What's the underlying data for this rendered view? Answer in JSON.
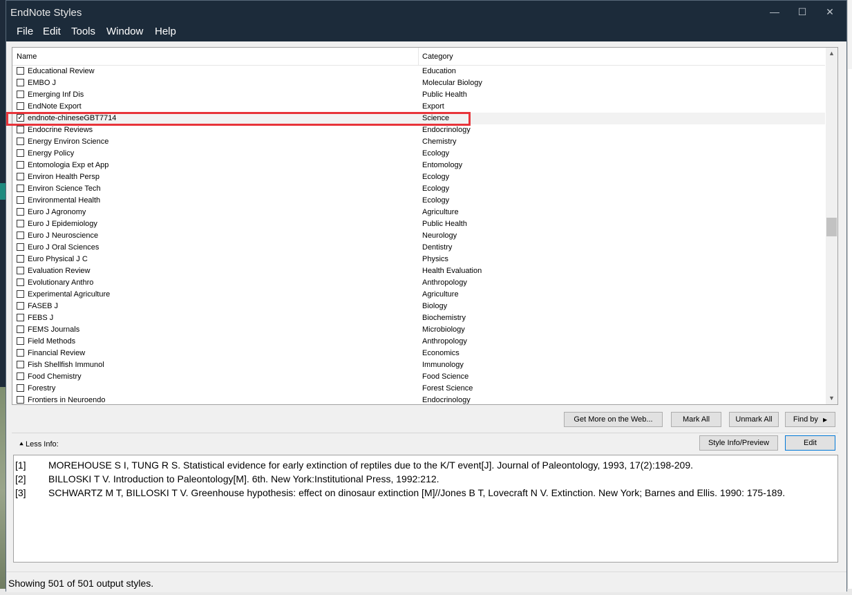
{
  "window": {
    "title": "EndNote Styles"
  },
  "menu": [
    "File",
    "Edit",
    "Tools",
    "Window",
    "Help"
  ],
  "columns": {
    "name": "Name",
    "category": "Category"
  },
  "styles": [
    {
      "name": "Educational Review",
      "category": "Education",
      "checked": false
    },
    {
      "name": "EMBO J",
      "category": "Molecular Biology",
      "checked": false
    },
    {
      "name": "Emerging Inf Dis",
      "category": "Public Health",
      "checked": false
    },
    {
      "name": "EndNote Export",
      "category": "Export",
      "checked": false
    },
    {
      "name": "endnote-chineseGBT7714",
      "category": "Science",
      "checked": true,
      "selected": true
    },
    {
      "name": "Endocrine Reviews",
      "category": "Endocrinology",
      "checked": false
    },
    {
      "name": "Energy Environ Science",
      "category": "Chemistry",
      "checked": false
    },
    {
      "name": "Energy Policy",
      "category": "Ecology",
      "checked": false
    },
    {
      "name": "Entomologia Exp et App",
      "category": "Entomology",
      "checked": false
    },
    {
      "name": "Environ Health Persp",
      "category": "Ecology",
      "checked": false
    },
    {
      "name": "Environ Science Tech",
      "category": "Ecology",
      "checked": false
    },
    {
      "name": "Environmental Health",
      "category": "Ecology",
      "checked": false
    },
    {
      "name": "Euro J Agronomy",
      "category": "Agriculture",
      "checked": false
    },
    {
      "name": "Euro J Epidemiology",
      "category": "Public Health",
      "checked": false
    },
    {
      "name": "Euro J Neuroscience",
      "category": "Neurology",
      "checked": false
    },
    {
      "name": "Euro J Oral Sciences",
      "category": "Dentistry",
      "checked": false
    },
    {
      "name": "Euro Physical J C",
      "category": "Physics",
      "checked": false
    },
    {
      "name": "Evaluation Review",
      "category": "Health Evaluation",
      "checked": false
    },
    {
      "name": "Evolutionary Anthro",
      "category": "Anthropology",
      "checked": false
    },
    {
      "name": "Experimental Agriculture",
      "category": "Agriculture",
      "checked": false
    },
    {
      "name": "FASEB J",
      "category": "Biology",
      "checked": false
    },
    {
      "name": "FEBS J",
      "category": "Biochemistry",
      "checked": false
    },
    {
      "name": "FEMS Journals",
      "category": "Microbiology",
      "checked": false
    },
    {
      "name": "Field Methods",
      "category": "Anthropology",
      "checked": false
    },
    {
      "name": "Financial Review",
      "category": "Economics",
      "checked": false
    },
    {
      "name": "Fish Shellfish Immunol",
      "category": "Immunology",
      "checked": false
    },
    {
      "name": "Food Chemistry",
      "category": "Food Science",
      "checked": false
    },
    {
      "name": "Forestry",
      "category": "Forest Science",
      "checked": false
    },
    {
      "name": "Frontiers in Neuroendo",
      "category": "Endocrinology",
      "checked": false
    }
  ],
  "buttons": {
    "get_more": "Get More on the Web...",
    "mark_all": "Mark All",
    "unmark_all": "Unmark All",
    "find_by": "Find by",
    "style_info": "Style Info/Preview",
    "edit": "Edit"
  },
  "less_info": "Less Info:",
  "preview": [
    {
      "num": "[1]",
      "text": "MOREHOUSE S I, TUNG R S. Statistical evidence for early extinction of reptiles due to the K/T event[J]. Journal of Paleontology, 1993, 17(2):198-209."
    },
    {
      "num": "[2]",
      "text": "BILLOSKI T V. Introduction to Paleontology[M]. 6th. New York:Institutional Press, 1992:212."
    },
    {
      "num": "[3]",
      "text": "SCHWARTZ M T, BILLOSKI T V. Greenhouse hypothesis: effect on dinosaur extinction [M]//Jones B T, Lovecraft N V. Extinction. New York; Barnes and Ellis. 1990: 175-189."
    }
  ],
  "status": "Showing 501 of 501 output styles.",
  "colors": {
    "titlebar": "#1c2b3a",
    "highlight": "#e8343a",
    "accent": "#0078d7"
  }
}
